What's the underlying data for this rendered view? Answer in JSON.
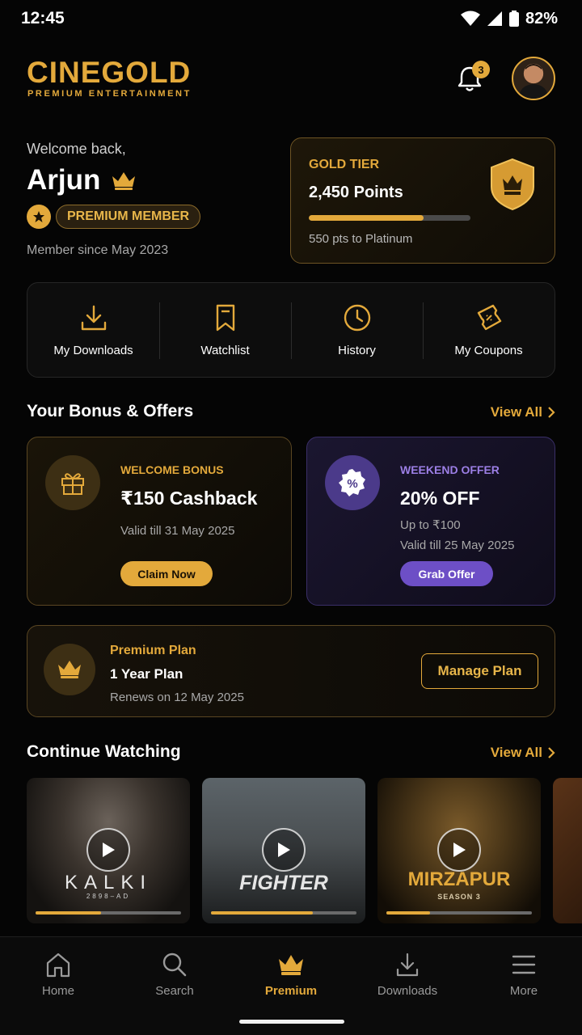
{
  "status_bar": {
    "time": "12:45",
    "battery": "82%"
  },
  "header": {
    "logo": "CINEGOLD",
    "logo_sub": "PREMIUM ENTERTAINMENT",
    "notification_count": "3"
  },
  "profile": {
    "welcome": "Welcome back,",
    "name": "Arjun",
    "membership_badge": "PREMIUM MEMBER",
    "member_since": "Member since May 2023"
  },
  "tier": {
    "title": "GOLD TIER",
    "points": "2,450 Points",
    "progress_fraction": 0.71,
    "next": "550 pts to Platinum"
  },
  "quick_actions": [
    {
      "label": "My Downloads",
      "icon": "download-icon"
    },
    {
      "label": "Watchlist",
      "icon": "bookmark-icon"
    },
    {
      "label": "History",
      "icon": "clock-icon"
    },
    {
      "label": "My Coupons",
      "icon": "coupon-icon"
    }
  ],
  "offers_section": {
    "title": "Your Bonus & Offers",
    "view_all": "View All"
  },
  "offers": [
    {
      "tag": "WELCOME BONUS",
      "headline": "₹150 Cashback",
      "sub": "Valid till 31 May 2025",
      "button": "Claim Now",
      "icon": "gift-icon"
    },
    {
      "tag": "WEEKEND OFFER",
      "headline": "20% OFF",
      "sub": "Up to ₹100",
      "sub2": "Valid till 25 May 2025",
      "button": "Grab Offer",
      "icon": "percent-badge-icon"
    }
  ],
  "plan": {
    "tag": "Premium Plan",
    "name": "1 Year Plan",
    "renews": "Renews on 12 May 2025",
    "button": "Manage Plan"
  },
  "continue_section": {
    "title": "Continue Watching",
    "view_all": "View All"
  },
  "continue_watching": [
    {
      "title": "KALKI",
      "subtitle": "2898–AD",
      "progress": 0.45
    },
    {
      "title": "FIGHTER",
      "progress": 0.7
    },
    {
      "title": "MIRZAPUR",
      "subtitle": "SEASON 3",
      "progress": 0.3
    }
  ],
  "bottom_nav": [
    {
      "label": "Home",
      "icon": "home-icon"
    },
    {
      "label": "Search",
      "icon": "search-icon"
    },
    {
      "label": "Premium",
      "icon": "crown-icon",
      "active": true
    },
    {
      "label": "Downloads",
      "icon": "download-icon"
    },
    {
      "label": "More",
      "icon": "menu-icon"
    }
  ],
  "colors": {
    "accent": "#e3a93b",
    "offer_purple": "#6d4fc6",
    "background": "#050505"
  }
}
